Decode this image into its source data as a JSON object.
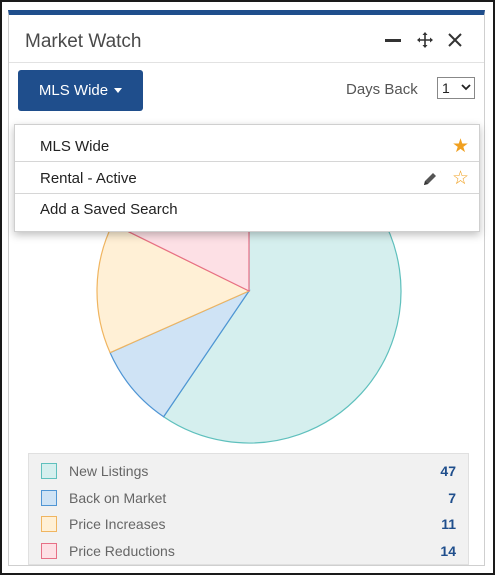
{
  "widget": {
    "title": "Market Watch",
    "minimize_icon": "minimize-icon",
    "move_icon": "move-icon",
    "close_icon": "close-icon"
  },
  "toolbar": {
    "search_button_label": "MLS Wide",
    "days_back_label": "Days Back",
    "days_back_value": "1"
  },
  "dropdown": {
    "items": [
      {
        "label": "MLS Wide",
        "favorite": true
      },
      {
        "label": "Rental - Active",
        "favorite": false,
        "editable": true
      },
      {
        "label": "Add a Saved Search"
      }
    ]
  },
  "chart_data": {
    "type": "pie",
    "series": [
      {
        "name": "New Listings",
        "value": 47,
        "fill": "#d5efee",
        "stroke": "#5fc0bd"
      },
      {
        "name": "Back on Market",
        "value": 7,
        "fill": "#cfe3f5",
        "stroke": "#4f95d4"
      },
      {
        "name": "Price Increases",
        "value": 11,
        "fill": "#fff0d6",
        "stroke": "#f0b560"
      },
      {
        "name": "Price Reductions",
        "value": 14,
        "fill": "#fde0e5",
        "stroke": "#e76f86"
      }
    ]
  },
  "colors": {
    "accent": "#1f4e8c",
    "star": "#f0a020"
  }
}
